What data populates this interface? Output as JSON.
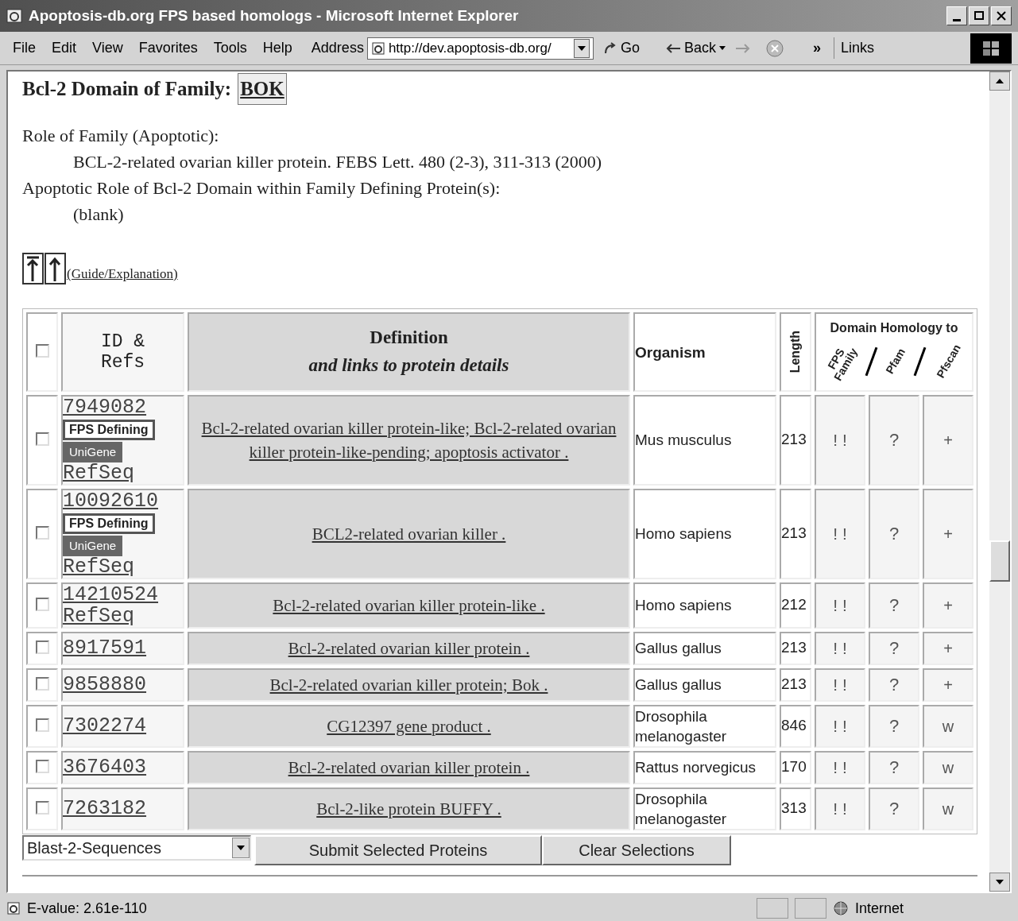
{
  "window": {
    "title": "Apoptosis-db.org FPS based homologs - Microsoft Internet Explorer"
  },
  "menu": [
    "File",
    "Edit",
    "View",
    "Favorites",
    "Tools",
    "Help"
  ],
  "address": {
    "label": "Address",
    "value": "http://dev.apoptosis-db.org/"
  },
  "toolbar": {
    "go": "Go",
    "back": "Back",
    "more": "»",
    "links": "Links"
  },
  "page": {
    "heading": "Bcl-2 Domain of Family:",
    "family": "BOK",
    "role_label": "Role of Family (Apoptotic):",
    "role_text": "BCL-2-related ovarian killer protein. FEBS Lett. 480 (2-3), 311-313 (2000)",
    "domain_label": "Apoptotic Role of Bcl-2 Domain within Family Defining Protein(s):",
    "domain_text": "(blank)",
    "guide_link": "(Guide/Explanation)"
  },
  "table": {
    "header": {
      "checked": false,
      "id": "ID &",
      "refs": "Refs",
      "definition": "Definition",
      "definition_sub": "and links to protein details",
      "organism": "Organism",
      "length": "Length",
      "homology": "Domain Homology to",
      "fps": "FPS Family",
      "pfam": "Pfam",
      "pfscan": "Pfscan"
    },
    "rows": [
      {
        "checked": false,
        "id": "7949082",
        "badges": [
          {
            "kind": "outline",
            "label": "FPS Defining"
          },
          {
            "kind": "filled",
            "label": "UniGene"
          }
        ],
        "refseq": "RefSeq",
        "definition": "Bcl-2-related ovarian killer protein-like; Bcl-2-related ovarian killer protein-like-pending; apoptosis activator .",
        "organism": "Mus musculus",
        "length": "213",
        "fps": "! !",
        "pfam": "?",
        "pfscan": "+"
      },
      {
        "checked": false,
        "id": "10092610",
        "badges": [
          {
            "kind": "outline",
            "label": "FPS Defining"
          },
          {
            "kind": "filled",
            "label": "UniGene"
          }
        ],
        "refseq": "RefSeq",
        "definition": "BCL2-related ovarian killer .",
        "organism": "Homo sapiens",
        "length": "213",
        "fps": "! !",
        "pfam": "?",
        "pfscan": "+"
      },
      {
        "checked": false,
        "id": "14210524",
        "refseq": "RefSeq",
        "definition": "Bcl-2-related ovarian killer protein-like .",
        "organism": "Homo sapiens",
        "length": "212",
        "fps": "! !",
        "pfam": "?",
        "pfscan": "+"
      },
      {
        "checked": false,
        "id": "8917591",
        "definition": "Bcl-2-related ovarian killer protein .",
        "organism": "Gallus gallus",
        "length": "213",
        "fps": "! !",
        "pfam": "?",
        "pfscan": "+"
      },
      {
        "checked": false,
        "id": "9858880",
        "definition": "Bcl-2-related ovarian killer protein; Bok .",
        "organism": "Gallus gallus",
        "length": "213",
        "fps": "! !",
        "pfam": "?",
        "pfscan": "+"
      },
      {
        "checked": false,
        "id": "7302274",
        "definition": "CG12397 gene product .",
        "organism": "Drosophila melanogaster",
        "length": "846",
        "fps": "! !",
        "pfam": "?",
        "pfscan": "w"
      },
      {
        "checked": false,
        "id": "3676403",
        "definition": "Bcl-2-related ovarian killer protein .",
        "organism": "Rattus norvegicus",
        "length": "170",
        "fps": "! !",
        "pfam": "?",
        "pfscan": "w"
      },
      {
        "checked": false,
        "id": "7263182",
        "definition": "Bcl-2-like protein BUFFY .",
        "organism": "Drosophila melanogaster",
        "length": "313",
        "fps": "! !",
        "pfam": "?",
        "pfscan": "w"
      }
    ]
  },
  "form": {
    "tool": "Blast-2-Sequences",
    "submit": "Submit Selected Proteins",
    "clear": "Clear Selections"
  },
  "status_bar": {
    "text": "E-value: 2.61e-110",
    "zone": "Internet"
  }
}
